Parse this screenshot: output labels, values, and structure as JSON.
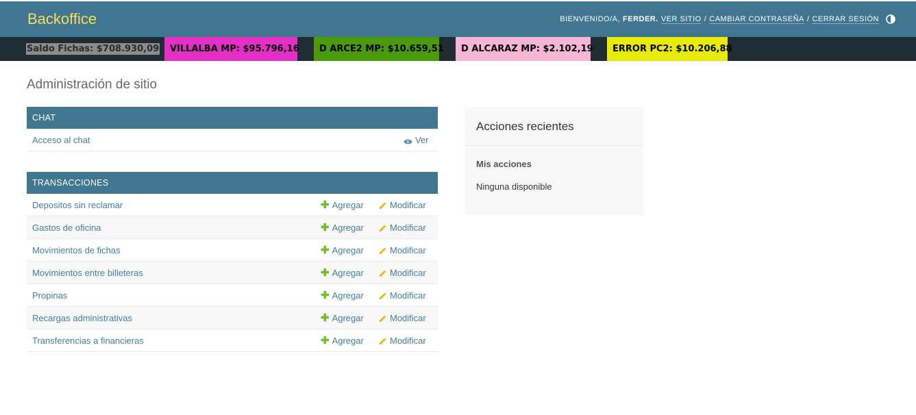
{
  "header": {
    "site_name": "Backoffice",
    "welcome": "BIENVENIDO/A,",
    "username": "FERDER.",
    "links": [
      "VER SITIO",
      "CAMBIAR CONTRASEÑA",
      "CERRAR SESIÓN"
    ],
    "separator": "/",
    "theme_icon": "contrast-toggle-icon"
  },
  "balances": [
    {
      "label": "Saldo Fichas: $708.930,09",
      "color": "#8c8c8c"
    },
    {
      "label": "VILLALBA MP: $95.796,16",
      "color": "#e22fc6"
    },
    {
      "label": "D ARCE2 MP: $10.659,51",
      "color": "#4b9a0c"
    },
    {
      "label": "D ALCARAZ MP: $2.102,19",
      "color": "#f8b6d7"
    },
    {
      "label": "ERROR PC2: $10.206,88",
      "color": "#e8eb0a"
    }
  ],
  "page_title": "Administración de sitio",
  "modules": {
    "chat": {
      "caption": "CHAT",
      "rows": [
        {
          "name": "Acceso al chat",
          "view": "Ver"
        }
      ]
    },
    "transacciones": {
      "caption": "TRANSACCIONES",
      "add_label": "Agregar",
      "change_label": "Modificar",
      "rows": [
        "Depositos sin reclamar",
        "Gastos de oficina",
        "Movimientos de fichas",
        "Movimientos entre billeteras",
        "Propinas",
        "Recargas administrativas",
        "Transferencias a financieras"
      ]
    }
  },
  "recent_actions": {
    "title": "Acciones recientes",
    "subtitle": "Mis acciones",
    "empty": "Ninguna disponible"
  },
  "colors": {
    "header_bg": "#417690",
    "site_name": "#f5dd5d",
    "link": "#447e9b",
    "add_icon": "#70bf2b",
    "change_icon": "#efb80b"
  }
}
